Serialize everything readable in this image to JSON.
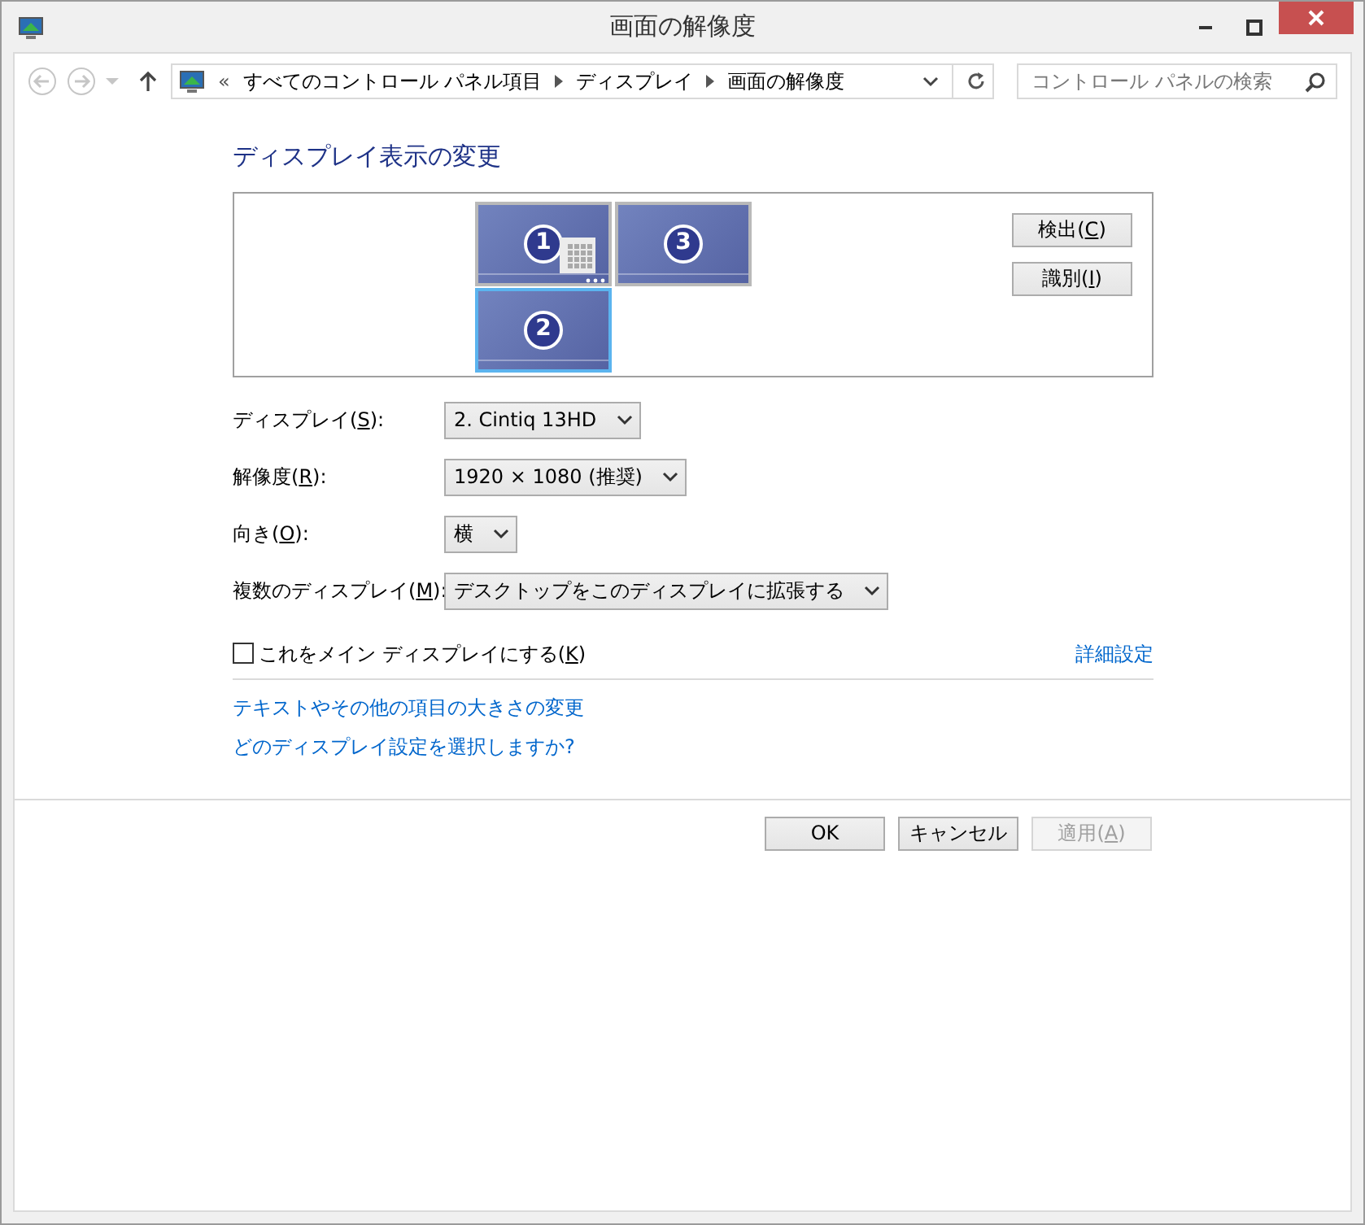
{
  "window": {
    "title": "画面の解像度"
  },
  "address_bar": {
    "overflow": "«",
    "path": [
      "すべてのコントロール パネル項目",
      "ディスプレイ",
      "画面の解像度"
    ]
  },
  "search": {
    "placeholder": "コントロール パネルの検索"
  },
  "heading": "ディスプレイ表示の変更",
  "monitors": [
    {
      "number": "1",
      "selected": false,
      "primary": true
    },
    {
      "number": "3",
      "selected": false,
      "primary": false
    },
    {
      "number": "2",
      "selected": true,
      "primary": false
    }
  ],
  "side_buttons": [
    {
      "text": "検出(",
      "key": "C",
      "after": ")"
    },
    {
      "text": "識別(",
      "key": "I",
      "after": ")"
    }
  ],
  "settings": [
    {
      "label": {
        "text": "ディスプレイ(",
        "key": "S",
        "after": "):"
      },
      "value": "2. Cintiq 13HD"
    },
    {
      "label": {
        "text": "解像度(",
        "key": "R",
        "after": "):"
      },
      "value": "1920 × 1080 (推奨)"
    },
    {
      "label": {
        "text": "向き(",
        "key": "O",
        "after": "):"
      },
      "value": "横"
    },
    {
      "label": {
        "text": "複数のディスプレイ(",
        "key": "M",
        "after": "):"
      },
      "value": "デスクトップをこのディスプレイに拡張する"
    }
  ],
  "main_display": {
    "label": {
      "text": "これをメイン ディスプレイにする(",
      "key": "K",
      "after": ")"
    },
    "checked": false
  },
  "advanced_link": "詳細設定",
  "links": [
    "テキストやその他の項目の大きさの変更",
    "どのディスプレイ設定を選択しますか?"
  ],
  "footer_buttons": [
    {
      "label": {
        "text": "OK"
      },
      "disabled": false
    },
    {
      "label": {
        "text": "キャンセル"
      },
      "disabled": false
    },
    {
      "label": {
        "text": "適用(",
        "key": "A",
        "after": ")"
      },
      "disabled": true
    }
  ]
}
